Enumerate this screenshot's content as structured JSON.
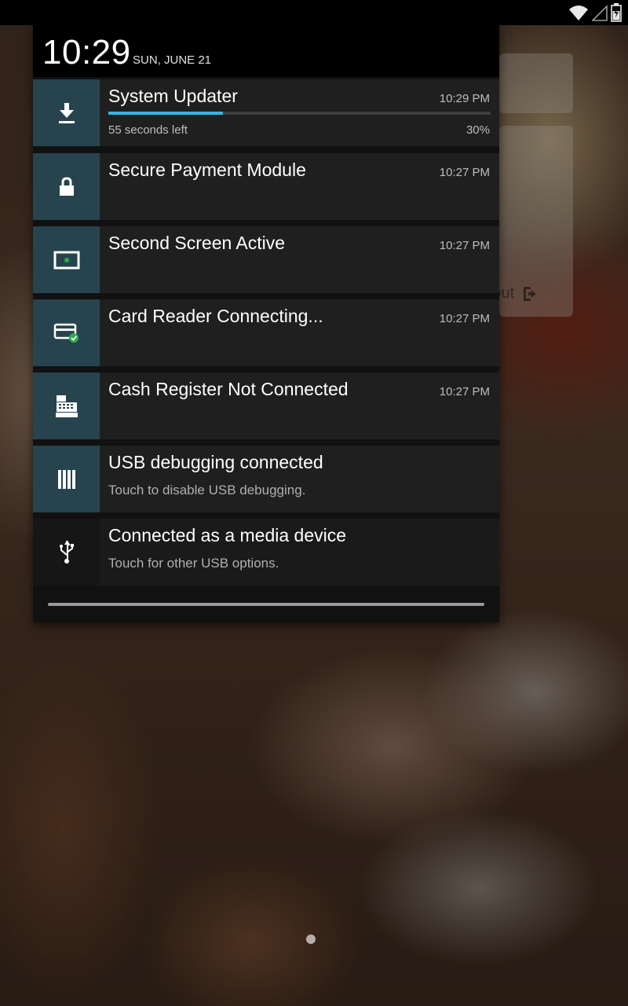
{
  "status_bar": {
    "icons": [
      "wifi-icon",
      "signal-icon",
      "battery-icon"
    ]
  },
  "shade": {
    "clock": "10:29",
    "date": "SUN, JUNE 21"
  },
  "notifications": [
    {
      "title": "System Updater",
      "time": "10:29 PM",
      "progress_text": "55 seconds left",
      "progress_percent_label": "30%",
      "progress_fraction": 0.3,
      "icon": "download-icon"
    },
    {
      "title": "Secure Payment Module",
      "time": "10:27 PM",
      "icon": "lock-icon"
    },
    {
      "title": "Second Screen Active",
      "time": "10:27 PM",
      "icon": "screen-icon"
    },
    {
      "title": "Card Reader Connecting...",
      "time": "10:27 PM",
      "icon": "card-reader-icon"
    },
    {
      "title": "Cash Register Not Connected",
      "time": "10:27 PM",
      "icon": "cash-register-icon"
    },
    {
      "title": "USB debugging connected",
      "subtitle": "Touch to disable USB debugging.",
      "icon": "usb-debug-icon"
    },
    {
      "title": "Connected as a media device",
      "subtitle": "Touch for other USB options.",
      "icon": "usb-icon"
    }
  ],
  "background": {
    "logout_label": "Logout"
  },
  "colors": {
    "accent": "#33b5e5",
    "icon_tile": "#27444e",
    "card_ok": "#2eaa4f"
  }
}
